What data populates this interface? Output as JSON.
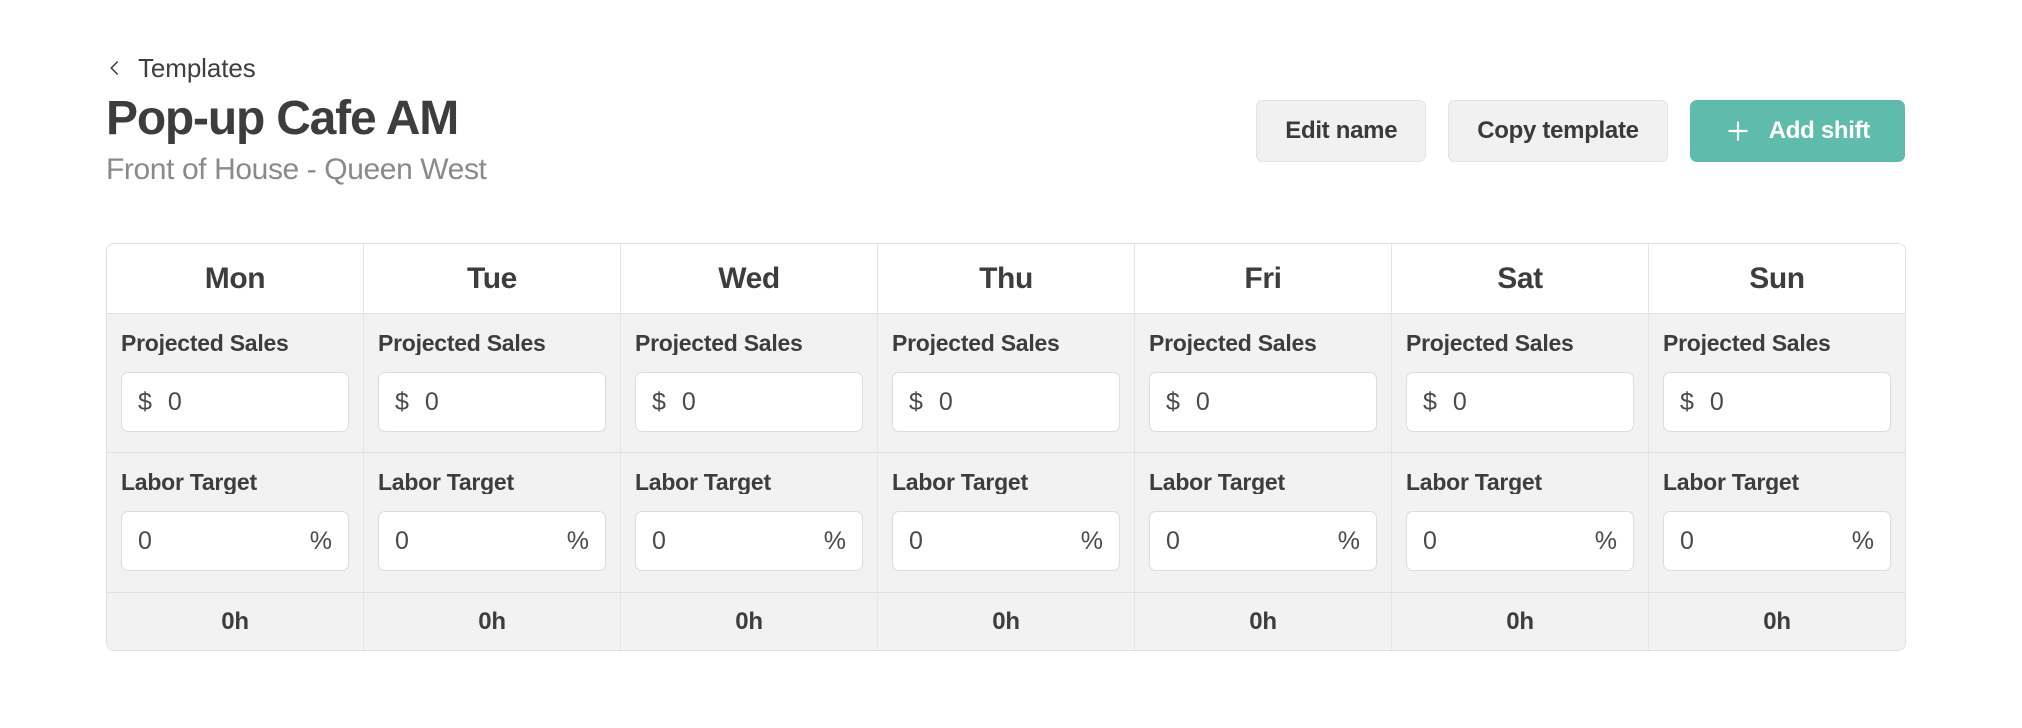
{
  "breadcrumb": {
    "icon": "chevron-left-icon",
    "label": "Templates"
  },
  "header": {
    "title": "Pop-up Cafe AM",
    "subtitle": "Front of House - Queen West",
    "actions": {
      "edit_name": "Edit name",
      "copy_template": "Copy template",
      "add_shift": "Add shift",
      "add_shift_icon": "plus-icon"
    }
  },
  "theme": {
    "accent": "#5fbcad",
    "button_bg": "#f1f1f1",
    "row_bg": "#f2f2f2",
    "border": "#e0e0e0",
    "text": "#3d3d3d",
    "muted_text": "#8a8a8a"
  },
  "table": {
    "field_labels": {
      "projected_sales": "Projected Sales",
      "labor_target": "Labor Target"
    },
    "affixes": {
      "currency": "$",
      "percent": "%"
    },
    "columns": [
      {
        "day": "Mon",
        "projected_sales": "0",
        "labor_target": "0",
        "total_hours": "0h"
      },
      {
        "day": "Tue",
        "projected_sales": "0",
        "labor_target": "0",
        "total_hours": "0h"
      },
      {
        "day": "Wed",
        "projected_sales": "0",
        "labor_target": "0",
        "total_hours": "0h"
      },
      {
        "day": "Thu",
        "projected_sales": "0",
        "labor_target": "0",
        "total_hours": "0h"
      },
      {
        "day": "Fri",
        "projected_sales": "0",
        "labor_target": "0",
        "total_hours": "0h"
      },
      {
        "day": "Sat",
        "projected_sales": "0",
        "labor_target": "0",
        "total_hours": "0h"
      },
      {
        "day": "Sun",
        "projected_sales": "0",
        "labor_target": "0",
        "total_hours": "0h"
      }
    ]
  }
}
